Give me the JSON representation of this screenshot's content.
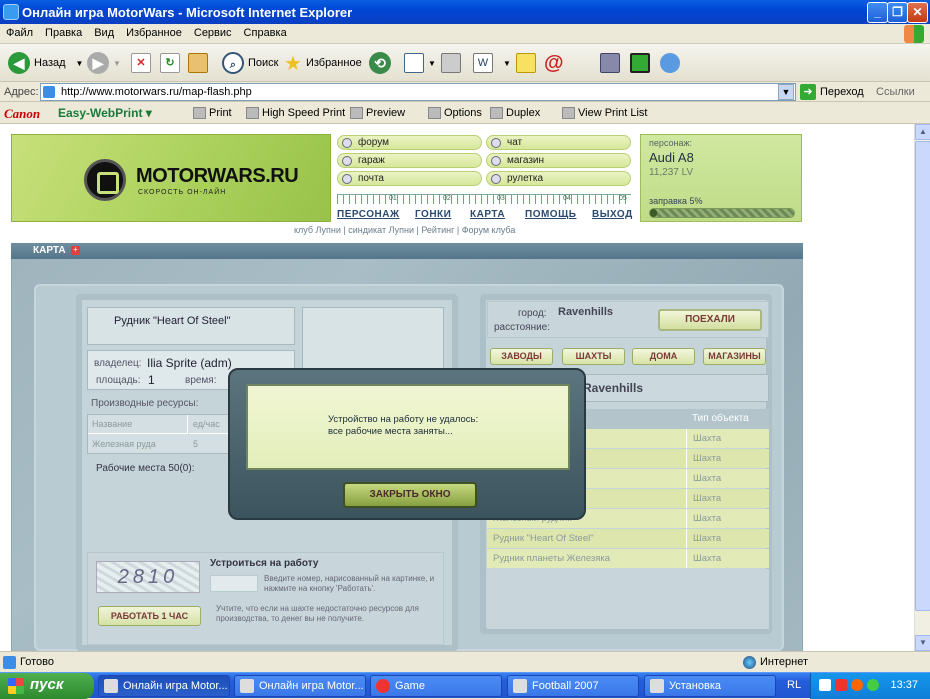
{
  "window": {
    "title": "Онлайн игра MotorWars - Microsoft Internet Explorer"
  },
  "menu": [
    "Файл",
    "Правка",
    "Вид",
    "Избранное",
    "Сервис",
    "Справка"
  ],
  "toolbar": {
    "back": "Назад",
    "search": "Поиск",
    "favorites": "Избранное"
  },
  "address": {
    "label": "Адрес:",
    "url": "http://www.motorwars.ru/map-flash.php",
    "go": "Переход",
    "links": "Ссылки"
  },
  "canon": {
    "brand": "Canon",
    "product": "Easy-WebPrint",
    "print": "Print",
    "hsprint": "High Speed Print",
    "preview": "Preview",
    "options": "Options",
    "duplex": "Duplex",
    "list": "View Print List"
  },
  "logo": {
    "name": "MOTORWARS.RU",
    "sub": "СКОРОСТЬ ОН-ЛАЙН"
  },
  "nav": {
    "forum": "форум",
    "chat": "чат",
    "garage": "гараж",
    "shop": "магазин",
    "mail": "почта",
    "roulette": "рулетка"
  },
  "ruler": [
    "01",
    "02",
    "03",
    "04",
    "05"
  ],
  "mainlinks": [
    "ПЕРСОНАЖ",
    "ГОНКИ",
    "КАРТА",
    "ПОМОЩЬ",
    "ВЫХОД"
  ],
  "clubs": "клуб Лупни | синдикат Лупни | Рейтинг | Форум клуба",
  "character": {
    "label": "персонаж:",
    "car": "Audi A8",
    "lv": "11,237 LV",
    "fuel_label": "заправка 5%",
    "fuel_pct": 5
  },
  "map": {
    "title": "КАРТА"
  },
  "mine": {
    "name": "Рудник \"Heart Of Steel\"",
    "owner_label": "владелец:",
    "owner": "Ilia Sprite (adm)",
    "area_label": "площадь:",
    "area": "1",
    "time_label": "время:",
    "resources_label": "Производные ресурсы:",
    "res_headers": [
      "Название",
      "ед/час"
    ],
    "res_rows": [
      {
        "name": "Железная руда",
        "value": "5"
      }
    ],
    "workplaces": "Рабочие места 50(0):",
    "job_title": "Устроиться на работу",
    "job_hint": "Введите номер, нарисованный на картинке, и нажмите на кнопку 'Работать'.",
    "captcha": "2810",
    "work_btn": "РАБОТАТЬ 1 ЧАС",
    "note": "Учтите, что если на шахте недостаточно ресурсов для производства, то денег вы не получите."
  },
  "city": {
    "city_label": "город:",
    "city": "Ravenhills",
    "distance_label": "расстояние:",
    "go_btn": "ПОЕХАЛИ",
    "tabs": [
      "ЗАВОДЫ",
      "ШАХТЫ",
      "ДОМА",
      "МАГАЗИНЫ"
    ],
    "list_title": "Ravenhills",
    "type_header": "Тип объекта",
    "rows": [
      {
        "name": "омнинь и Чугунь\"",
        "type": "Шахта"
      },
      {
        "name": "омнинь и Чугунь\"",
        "type": "Шахта"
      },
      {
        "name": "к",
        "type": "Шахта"
      },
      {
        "name": "",
        "type": "Шахта"
      },
      {
        "name": "Железный рудник",
        "type": "Шахта"
      },
      {
        "name": "Рудник \"Heart Of Steel\"",
        "type": "Шахта"
      },
      {
        "name": "Рудник планеты Железяка",
        "type": "Шахта"
      }
    ]
  },
  "popup": {
    "line1": "Устройство на работу не удалось:",
    "line2": "все рабочие места заняты...",
    "close": "ЗАКРЫТЬ ОКНО"
  },
  "status": {
    "left": "Готово",
    "zone": "Интернет"
  },
  "taskbar": {
    "start": "пуск",
    "tasks": [
      "Онлайн игра Motor...",
      "Онлайн игра Motor...",
      "Game",
      "Football 2007",
      "Установка"
    ],
    "lang": "RL",
    "clock": "13:37"
  }
}
